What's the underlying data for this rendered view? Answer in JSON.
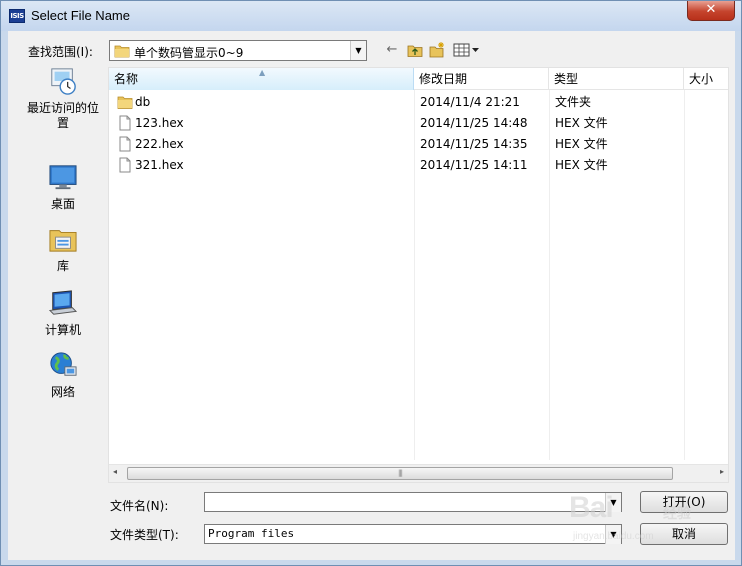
{
  "window": {
    "title": "Select File Name",
    "app_icon_text": "ISIS",
    "close_glyph": "✕"
  },
  "lookin": {
    "label": "查找范围(I):",
    "current_folder": "单个数码管显示0~9",
    "dropdown_icon": "chevron-down-icon"
  },
  "toolbar": {
    "back_glyph": "←",
    "up_glyph": "📁",
    "new_folder_glyph": "✱",
    "view_menu_glyph": "▦▾"
  },
  "places": [
    {
      "label": "最近访问的位置",
      "icon": "recent-places-icon"
    },
    {
      "label": "桌面",
      "icon": "desktop-icon"
    },
    {
      "label": "库",
      "icon": "libraries-icon"
    },
    {
      "label": "计算机",
      "icon": "computer-icon"
    },
    {
      "label": "网络",
      "icon": "network-icon"
    }
  ],
  "columns": {
    "name": "名称",
    "date": "修改日期",
    "type": "类型",
    "size": "大小"
  },
  "files": [
    {
      "name": "db",
      "date": "2014/11/4 21:21",
      "type": "文件夹",
      "kind": "folder"
    },
    {
      "name": "123.hex",
      "date": "2014/11/25 14:48",
      "type": "HEX 文件",
      "kind": "file"
    },
    {
      "name": "222.hex",
      "date": "2014/11/25 14:35",
      "type": "HEX 文件",
      "kind": "file"
    },
    {
      "name": "321.hex",
      "date": "2014/11/25 14:11",
      "type": "HEX 文件",
      "kind": "file"
    }
  ],
  "scrollbar": {
    "left_glyph": "◂",
    "right_glyph": "▸",
    "grip": "|||"
  },
  "filename": {
    "label": "文件名(N):",
    "value": "",
    "placeholder": ""
  },
  "filetype": {
    "label": "文件类型(T):",
    "selected": "Program files"
  },
  "buttons": {
    "open": "打开(O)",
    "cancel": "取消"
  },
  "watermark": {
    "main": "Bai",
    "sub": "经验",
    "url": "jingyan.baidu.com"
  }
}
